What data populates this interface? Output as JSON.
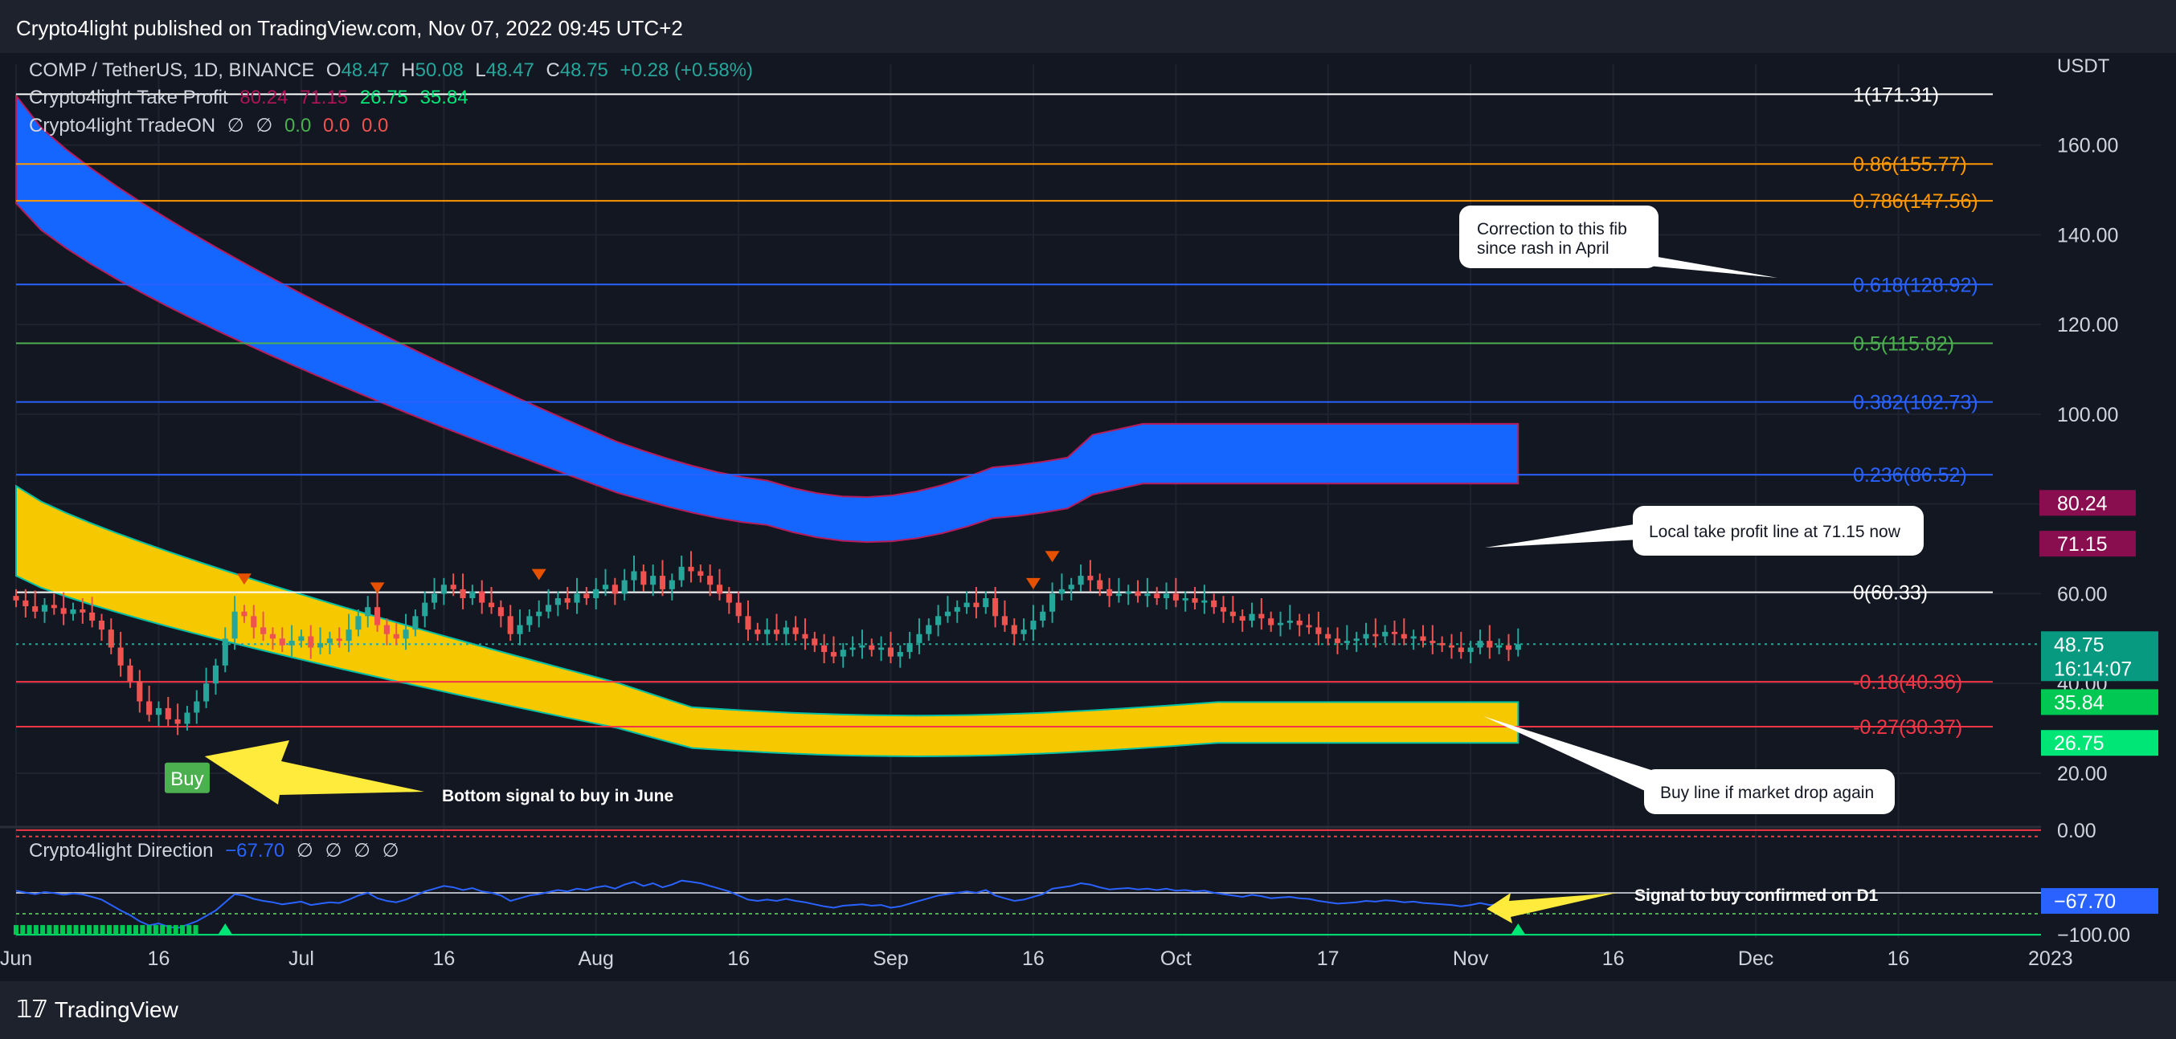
{
  "publish_line": "Crypto4light published on TradingView.com, Nov 07, 2022 09:45 UTC+2",
  "brand": "TradingView",
  "currency": "USDT",
  "legend": {
    "symbol": "COMP / TetherUS, 1D, BINANCE",
    "o_label": "O",
    "o": "48.47",
    "h_label": "H",
    "h": "50.08",
    "l_label": "L",
    "l": "48.47",
    "c_label": "C",
    "c": "48.75",
    "change": "+0.28 (+0.58%)",
    "tp_name": "Crypto4light Take Profit",
    "tp_values": [
      "80.24",
      "71.15",
      "26.75",
      "35.84"
    ],
    "tradeon_name": "Crypto4light TradeON",
    "tradeon_nulls": [
      "∅",
      "∅"
    ],
    "tradeon_values": [
      "0.0",
      "0.0",
      "0.0"
    ],
    "direction_name": "Crypto4light Direction",
    "direction_value": "−67.70",
    "direction_nulls": [
      "∅",
      "∅",
      "∅",
      "∅"
    ]
  },
  "colors": {
    "background": "#131722",
    "panel": "#1e222d",
    "up": "#26a69a",
    "down": "#ef5350",
    "blue_band": "#1565ff",
    "yellow_band": "#f5c800",
    "direction_line": "#2962ff"
  },
  "chart_data": {
    "type": "candlestick",
    "y_axis_unit": "USDT",
    "ylim": [
      8,
      178
    ],
    "y_ticks": [
      "160.00",
      "140.00",
      "120.00",
      "100.00",
      "60.00",
      "20.00"
    ],
    "x_ticks": [
      "Jun",
      "16",
      "Jul",
      "16",
      "Aug",
      "16",
      "Sep",
      "16",
      "Oct",
      "17",
      "Nov",
      "16",
      "Dec",
      "16",
      "2023"
    ],
    "x_range": [
      "2022-06-01",
      "2022-12-31"
    ],
    "close_series": {
      "dates_start": "2022-06-01",
      "values": [
        58.5,
        57.2,
        56.0,
        57.5,
        56.8,
        55.5,
        56.5,
        55.8,
        54.0,
        52.0,
        48.0,
        44.0,
        40.5,
        36.0,
        33.0,
        34.5,
        32.0,
        31.0,
        33.5,
        36.0,
        40.0,
        44.0,
        50.0,
        56.0,
        55.0,
        52.5,
        51.0,
        50.0,
        48.5,
        49.5,
        50.5,
        48.0,
        49.0,
        50.0,
        49.5,
        52.0,
        55.0,
        57.0,
        53.0,
        51.0,
        50.0,
        52.0,
        55.0,
        58.0,
        60.0,
        62.0,
        61.0,
        59.0,
        60.5,
        58.0,
        57.0,
        55.0,
        51.0,
        53.0,
        55.0,
        56.0,
        57.5,
        59.0,
        58.0,
        60.0,
        59.0,
        61.0,
        62.0,
        60.0,
        63.0,
        65.0,
        62.0,
        64.0,
        61.0,
        63.0,
        66.0,
        65.0,
        64.0,
        62.0,
        60.0,
        58.0,
        55.0,
        52.0,
        51.0,
        52.0,
        51.0,
        52.5,
        51.0,
        50.0,
        48.5,
        47.0,
        46.0,
        47.5,
        48.0,
        48.5,
        47.5,
        48.0,
        46.0,
        47.0,
        49.0,
        51.0,
        53.0,
        55.0,
        56.0,
        57.0,
        58.0,
        57.0,
        59.0,
        55.0,
        53.0,
        51.0,
        52.0,
        54.0,
        56.0,
        60.0,
        61.0,
        62.0,
        64.0,
        63.0,
        61.0,
        59.5,
        60.0,
        60.5,
        59.5,
        60.0,
        59.0,
        60.0,
        58.5,
        59.0,
        58.0,
        58.5,
        57.0,
        56.0,
        55.0,
        54.0,
        55.5,
        54.5,
        53.0,
        53.5,
        54.0,
        53.0,
        52.5,
        51.0,
        50.0,
        49.0,
        49.5,
        50.0,
        51.0,
        50.5,
        51.5,
        51.0,
        50.0,
        50.5,
        49.5,
        49.0,
        48.5,
        48.0,
        47.0,
        48.0,
        49.5,
        48.0,
        48.5,
        47.5,
        48.75
      ]
    },
    "fib_levels": [
      {
        "label": "1(171.31)",
        "value": 171.31,
        "color": "#ffffff"
      },
      {
        "label": "0.86(155.77)",
        "value": 155.77,
        "color": "#ff9800"
      },
      {
        "label": "0.786(147.56)",
        "value": 147.56,
        "color": "#ff9800"
      },
      {
        "label": "0.618(128.92)",
        "value": 128.92,
        "color": "#2962ff"
      },
      {
        "label": "0.5(115.82)",
        "value": 115.82,
        "color": "#4caf50"
      },
      {
        "label": "0.382(102.73)",
        "value": 102.73,
        "color": "#2962ff"
      },
      {
        "label": "0.236(86.52)",
        "value": 86.52,
        "color": "#2962ff"
      },
      {
        "label": "0(60.33)",
        "value": 60.33,
        "color": "#ffffff"
      },
      {
        "label": "-0.18(40.36)",
        "value": 40.36,
        "color": "#f23645"
      },
      {
        "label": "-0.27(30.37)",
        "value": 30.37,
        "color": "#f23645"
      }
    ],
    "bands": {
      "blue_upper_start": 171,
      "blue_lower_start": 147,
      "blue_upper_end": 80.24,
      "blue_lower_end": 71.15,
      "yellow_upper_start": 84,
      "yellow_lower_start": 64,
      "yellow_upper_end": 35.84,
      "yellow_lower_end": 26.75
    },
    "price_labels": [
      {
        "text": "80.24",
        "value": 80.24,
        "color": "#880e4f"
      },
      {
        "text": "71.15",
        "value": 71.15,
        "color": "#880e4f"
      },
      {
        "text": "48.75",
        "value": 48.75,
        "color": "#089981"
      },
      {
        "text": "16:14:07",
        "value": 48.75,
        "color": "#089981"
      },
      {
        "text": "35.84",
        "value": 35.84,
        "color": "#00c853"
      },
      {
        "text": "26.75",
        "value": 26.75,
        "color": "#00e676"
      }
    ],
    "overlapped_tick": "40.00",
    "annotations": [
      {
        "text": "Correction to this fib since rash in April",
        "lines": [
          "Correction to this fib",
          "since rash in April"
        ]
      },
      {
        "text": "Local take profit line at 71.15 now"
      },
      {
        "text": "Buy line if market drop again"
      },
      {
        "text": "Bottom signal to buy in June"
      },
      {
        "text": "Signal to buy confirmed on D1"
      }
    ],
    "buy_label": "Buy",
    "direction": {
      "y_ticks": [
        "0.00",
        "−100.00"
      ],
      "current_label": "−67.70",
      "current": -67.7,
      "ylim": [
        -103,
        3
      ],
      "levels": [
        0,
        -60,
        -80,
        -100
      ]
    }
  }
}
